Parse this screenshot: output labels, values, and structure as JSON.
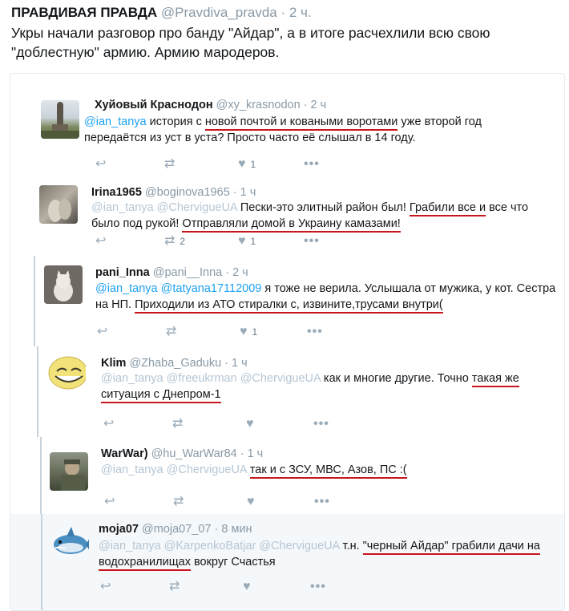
{
  "header": {
    "name": "ПРАВДИВАЯ ПРАВДА",
    "handle": "@Pravdiva_pravda",
    "sep": "·",
    "time": "2 ч.",
    "text": "Укры начали разговор про банду \"Айдар\", а в итоге расчехлили всю свою \"доблестную\" армию. Армию мародеров."
  },
  "icons": {
    "reply": "↩",
    "retweet": "⇄",
    "like": "♥",
    "more": "•••"
  },
  "tweets": [
    {
      "name": "Хуйовый Краснодон",
      "handle": "@xy_krasnodon",
      "time": "· 2 ч",
      "t1": "@ian_tanya",
      "t2": " история с ",
      "t3": "новой почтой и коваными воротами",
      "t4": " уже второй год передаётся из уст в уста? Просто часто её слышал в 14 году.",
      "retweets": "",
      "likes": "1"
    },
    {
      "name": "Irina1965",
      "handle": "@boginova1965",
      "time": "· 1 ч",
      "t1": "@ian_tanya @ChervigueUA",
      "t2": " Пески-это элитный район был! ",
      "t3": "Грабили все и",
      "t4": " все что было под рукой! ",
      "t5": "Отправляли домой в Украину камазами!",
      "retweets": "2",
      "likes": "1"
    },
    {
      "name": "pani_Inna",
      "handle": "@pani__Inna",
      "time": "· 2 ч",
      "t1": "@ian_tanya @tatyana17112009",
      "t2": " я тоже не верила. Услышала от мужика, у кот. Сестра на НП. ",
      "t3": "Приходили из АТО стиралки с, извините,трусами внутри(",
      "retweets": "",
      "likes": "1"
    },
    {
      "name": "Klim",
      "handle": "@Zhaba_Gaduku",
      "time": "· 1 ч",
      "t1": "@ian_tanya @freeukrman @ChervigueUA",
      "t2": " как и многие другие. Точно ",
      "t3": "такая же ситуация с Днепром-1",
      "retweets": "",
      "likes": ""
    },
    {
      "name": "WarWar)",
      "handle": "@hu_WarWar84",
      "time": "· 1 ч",
      "t1": "@ian_tanya @ChervigueUA",
      "t2": " ",
      "t3": "так и с ЗСУ, МВС, Азов, ПС :(",
      "retweets": "",
      "likes": ""
    },
    {
      "name": "moja07",
      "handle": "@moja07_07",
      "time": "· 8 мин",
      "t1": "@ian_tanya @KarpenkoBatjar @ChervigueUA",
      "t2": " т.н. ",
      "t3": "\"черный Айдар\" грабили дачи на водохранилищах",
      "t4": " вокруг Счастья",
      "retweets": "",
      "likes": ""
    }
  ]
}
